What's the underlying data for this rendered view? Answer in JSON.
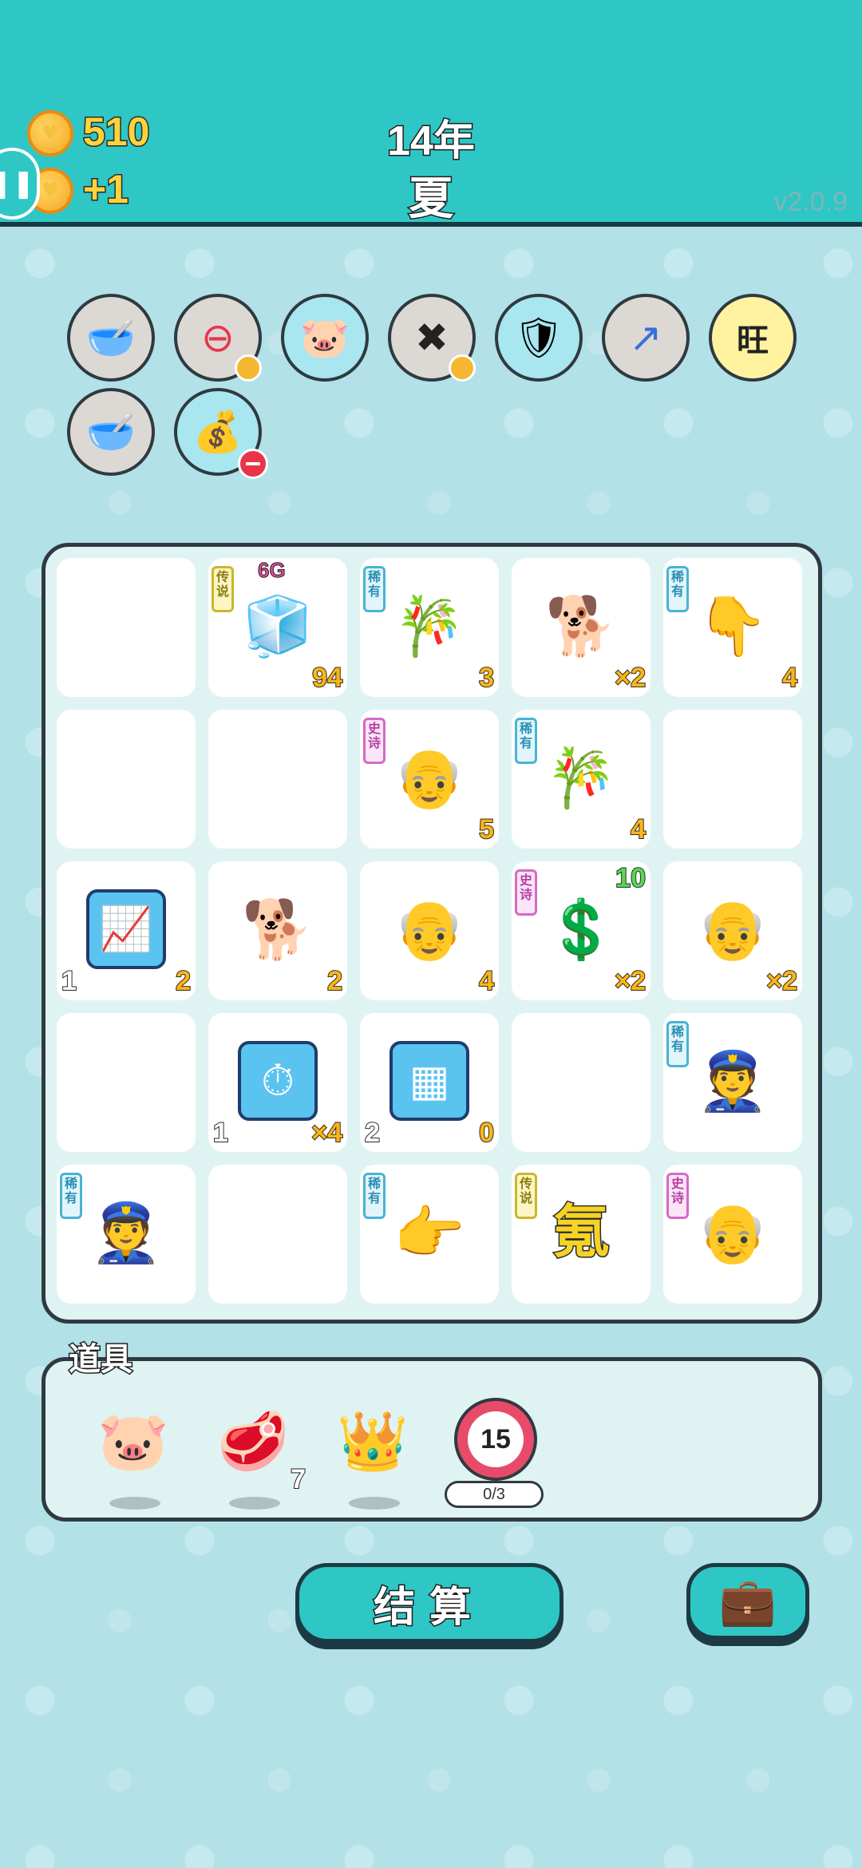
{
  "header": {
    "coins": "510",
    "income": "+1",
    "year": "14年",
    "season": "夏",
    "version": "v2.0.9"
  },
  "relics": [
    {
      "icon": "dog-food-bowl-icon",
      "glyph": "🥣"
    },
    {
      "icon": "minus-circle-icon",
      "glyph": "⊖"
    },
    {
      "icon": "piggy-bank-icon",
      "glyph": "🐷"
    },
    {
      "icon": "delete-tag-icon",
      "glyph": "✖"
    },
    {
      "icon": "shield-wrench-icon",
      "glyph": "🛡"
    },
    {
      "icon": "arrow-card-icon",
      "glyph": "↗"
    },
    {
      "icon": "wang-pattern-icon",
      "glyph": "旺"
    },
    {
      "icon": "dog-food-bowl-icon",
      "glyph": "🥣"
    },
    {
      "icon": "money-sack-icon",
      "glyph": "💰"
    }
  ],
  "board": [
    {
      "empty": true
    },
    {
      "tag": "传说",
      "tagType": "legend",
      "icon": "fridge-icon",
      "glyph": "🧊",
      "br": "94",
      "topLabel": "6G"
    },
    {
      "tag": "稀有",
      "tagType": "rare",
      "icon": "bamboo-icon",
      "glyph": "🎋",
      "br": "3"
    },
    {
      "icon": "husky-dog-icon",
      "glyph": "🐕",
      "br": "×2"
    },
    {
      "tag": "稀有",
      "tagType": "rare",
      "icon": "pointing-hand-down-icon",
      "glyph": "👇",
      "br": "4"
    },
    {
      "empty": true
    },
    {
      "empty": true
    },
    {
      "tag": "史诗",
      "tagType": "epic",
      "icon": "bearded-man-icon",
      "glyph": "👴",
      "br": "5"
    },
    {
      "tag": "稀有",
      "tagType": "rare",
      "icon": "bamboo-icon",
      "glyph": "🎋",
      "br": "4"
    },
    {
      "empty": true
    },
    {
      "icon": "trend-chart-card-icon",
      "glyph": "📈",
      "bl": "1",
      "br": "2",
      "blueTile": true
    },
    {
      "icon": "husky-dog-icon",
      "glyph": "🐕",
      "br": "2"
    },
    {
      "icon": "old-man-glasses-icon",
      "glyph": "👴",
      "br": "4"
    },
    {
      "tag": "史诗",
      "tagType": "epic",
      "icon": "broken-dollar-coin-icon",
      "glyph": "💲",
      "br": "×2",
      "tr": "10"
    },
    {
      "icon": "old-man-glasses-icon",
      "glyph": "👴",
      "br": "×2"
    },
    {
      "empty": true
    },
    {
      "icon": "stopwatch-card-icon",
      "glyph": "⏱",
      "bl": "1",
      "br": "×4",
      "blueTile": true
    },
    {
      "icon": "gold-bars-card-icon",
      "glyph": "▦",
      "bl": "2",
      "br": "0",
      "blueTile": true
    },
    {
      "empty": true
    },
    {
      "tag": "稀有",
      "tagType": "rare",
      "icon": "police-officer-icon",
      "glyph": "👮"
    },
    {
      "tag": "稀有",
      "tagType": "rare",
      "icon": "police-officer-icon",
      "glyph": "👮"
    },
    {
      "empty": true
    },
    {
      "tag": "稀有",
      "tagType": "rare",
      "icon": "pointing-hand-icon",
      "glyph": "👉"
    },
    {
      "tag": "传说",
      "tagType": "legend",
      "icon": "krypton-character-icon",
      "kanji": "氪"
    },
    {
      "tag": "史诗",
      "tagType": "epic",
      "icon": "sad-old-man-icon",
      "glyph": "👴"
    }
  ],
  "items": {
    "title": "道具",
    "list": [
      {
        "icon": "piggy-bank-coin-icon",
        "glyph": "🐷"
      },
      {
        "icon": "raw-meat-icon",
        "glyph": "🥩",
        "count": "7"
      },
      {
        "icon": "gold-crown-icon",
        "glyph": "👑"
      }
    ],
    "timer": "15",
    "progress": "0/3"
  },
  "buttons": {
    "settle": "结算",
    "bag_icon": "briefcase-icon",
    "bag_glyph": "💼"
  }
}
